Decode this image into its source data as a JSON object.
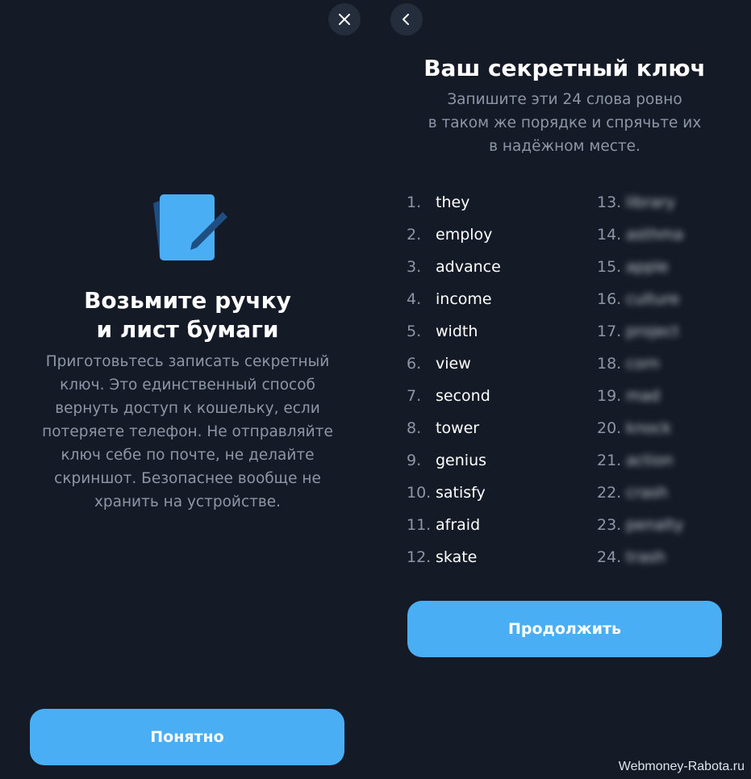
{
  "top_bar": {
    "close_icon": "close-icon",
    "back_icon": "chevron-left-icon"
  },
  "left_panel": {
    "illustration_icon": "notebook-pen-icon",
    "title": "Возьмите ручку\nи лист бумаги",
    "description": "Приготовьтесь записать секретный ключ. Это единственный способ вернуть доступ к кошельку, если потеряете телефон. Не отправляйте ключ себе по почте, не делайте скриншот. Безопаснее вообще не хранить на устройстве.",
    "button_label": "Понятно"
  },
  "right_panel": {
    "title": "Ваш секретный ключ",
    "subtitle": "Запишите эти 24 слова ровно\nв таком же порядке и спрячьте их\nв надёжном месте.",
    "words_left": [
      {
        "num": "1.",
        "word": "they"
      },
      {
        "num": "2.",
        "word": "employ"
      },
      {
        "num": "3.",
        "word": "advance"
      },
      {
        "num": "4.",
        "word": "income"
      },
      {
        "num": "5.",
        "word": "width"
      },
      {
        "num": "6.",
        "word": "view"
      },
      {
        "num": "7.",
        "word": "second"
      },
      {
        "num": "8.",
        "word": "tower"
      },
      {
        "num": "9.",
        "word": "genius"
      },
      {
        "num": "10.",
        "word": "satisfy"
      },
      {
        "num": "11.",
        "word": "afraid"
      },
      {
        "num": "12.",
        "word": "skate"
      }
    ],
    "words_right": [
      {
        "num": "13.",
        "word": "library"
      },
      {
        "num": "14.",
        "word": "asthma"
      },
      {
        "num": "15.",
        "word": "apple"
      },
      {
        "num": "16.",
        "word": "culture"
      },
      {
        "num": "17.",
        "word": "project"
      },
      {
        "num": "18.",
        "word": "corn"
      },
      {
        "num": "19.",
        "word": "mad"
      },
      {
        "num": "20.",
        "word": "knock"
      },
      {
        "num": "21.",
        "word": "action"
      },
      {
        "num": "22.",
        "word": "crash"
      },
      {
        "num": "23.",
        "word": "penalty"
      },
      {
        "num": "24.",
        "word": "trash"
      }
    ],
    "button_label": "Продолжить"
  },
  "watermark": "Webmoney-Rabota.ru",
  "colors": {
    "background": "#141b26",
    "accent": "#4aaef5",
    "muted_text": "#8d96a6",
    "icon_button_bg": "#242d3b"
  }
}
